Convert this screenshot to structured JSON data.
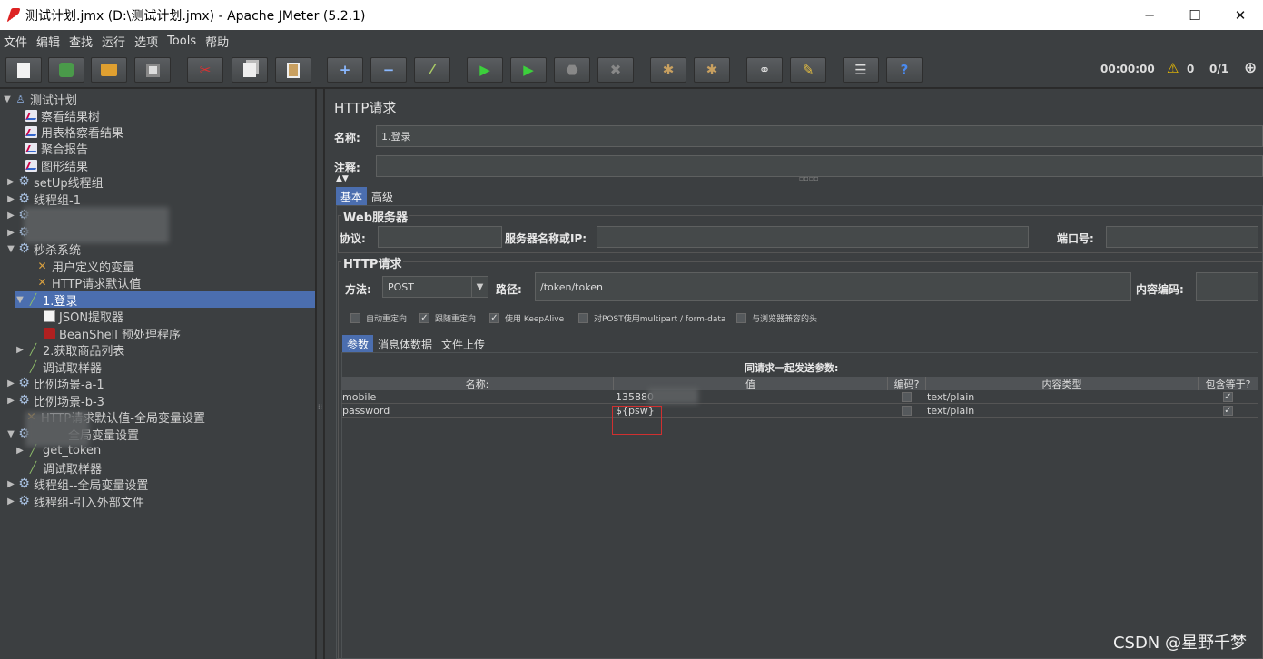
{
  "window": {
    "title": "测试计划.jmx (D:\\测试计划.jmx) - Apache JMeter (5.2.1)",
    "min": "─",
    "max": "☐",
    "close": "✕"
  },
  "menu": [
    "文件",
    "编辑",
    "查找",
    "运行",
    "选项",
    "Tools",
    "帮助"
  ],
  "status": {
    "elapsed": "00:00:00",
    "warnings": "0",
    "threads": "0/1"
  },
  "tree": [
    {
      "label": "测试计划",
      "arrow": "▼",
      "icon": "flask"
    },
    {
      "label": "察看结果树",
      "arrow": "",
      "icon": "graph"
    },
    {
      "label": "用表格察看结果",
      "arrow": "",
      "icon": "graph"
    },
    {
      "label": "聚合报告",
      "arrow": "",
      "icon": "graph"
    },
    {
      "label": "图形结果",
      "arrow": "",
      "icon": "graph"
    },
    {
      "label": "setUp线程组",
      "arrow": "▶",
      "icon": "gear"
    },
    {
      "label": "线程组-1",
      "arrow": "▶",
      "icon": "gear"
    },
    {
      "label": "",
      "arrow": "▶",
      "icon": "gear"
    },
    {
      "label": "",
      "arrow": "▶",
      "icon": "gear"
    },
    {
      "label": "秒杀系统",
      "arrow": "▼",
      "icon": "gear"
    },
    {
      "label": "用户定义的变量",
      "arrow": "",
      "icon": "tool"
    },
    {
      "label": "HTTP请求默认值",
      "arrow": "",
      "icon": "tool"
    },
    {
      "label": "1.登录",
      "arrow": "▼",
      "icon": "pipette",
      "selected": true
    },
    {
      "label": "JSON提取器",
      "arrow": "",
      "icon": "doc"
    },
    {
      "label": "BeanShell 预处理程序",
      "arrow": "",
      "icon": "bean"
    },
    {
      "label": "2.获取商品列表",
      "arrow": "▶",
      "icon": "pipette"
    },
    {
      "label": "调试取样器",
      "arrow": "",
      "icon": "pipette"
    },
    {
      "label": "比例场景-a-1",
      "arrow": "▶",
      "icon": "gear"
    },
    {
      "label": "比例场景-b-3",
      "arrow": "▶",
      "icon": "gear"
    },
    {
      "label": "HTTP请求默认值-全局变量设置",
      "arrow": "",
      "icon": "tool"
    },
    {
      "label": "全局变量设置",
      "arrow": "▼",
      "icon": "gear"
    },
    {
      "label": "get_token",
      "arrow": "▶",
      "icon": "pipette"
    },
    {
      "label": "调试取样器",
      "arrow": "",
      "icon": "pipette"
    },
    {
      "label": "线程组--全局变量设置",
      "arrow": "▶",
      "icon": "gear"
    },
    {
      "label": "线程组-引入外部文件",
      "arrow": "▶",
      "icon": "gear"
    }
  ],
  "panel": {
    "title": "HTTP请求",
    "name_label": "名称:",
    "name_value": "1.登录",
    "comment_label": "注释:",
    "tabs": [
      "基本",
      "高级"
    ],
    "web_server": {
      "title": "Web服务器",
      "protocol_label": "协议:",
      "server_label": "服务器名称或IP:",
      "port_label": "端口号:"
    },
    "http": {
      "title": "HTTP请求",
      "method_label": "方法:",
      "method": "POST",
      "path_label": "路径:",
      "path": "/token/token",
      "encoding_label": "内容编码:",
      "options": [
        {
          "label": "自动重定向",
          "checked": false
        },
        {
          "label": "跟随重定向",
          "checked": true
        },
        {
          "label": "使用 KeepAlive",
          "checked": true
        },
        {
          "label": "对POST使用multipart / form-data",
          "checked": false
        },
        {
          "label": "与浏览器兼容的头",
          "checked": false
        }
      ]
    },
    "sub_tabs": [
      "参数",
      "消息体数据",
      "文件上传"
    ],
    "params": {
      "caption": "同请求一起发送参数:",
      "headers": [
        "名称:",
        "值",
        "编码?",
        "内容类型",
        "包含等于?"
      ],
      "rows": [
        {
          "name": "mobile",
          "value": "135880",
          "encode": false,
          "type": "text/plain",
          "include_equals": true
        },
        {
          "name": "password",
          "value": "${psw}",
          "encode": false,
          "type": "text/plain",
          "include_equals": true
        }
      ]
    }
  },
  "watermark": "CSDN @星野千梦"
}
